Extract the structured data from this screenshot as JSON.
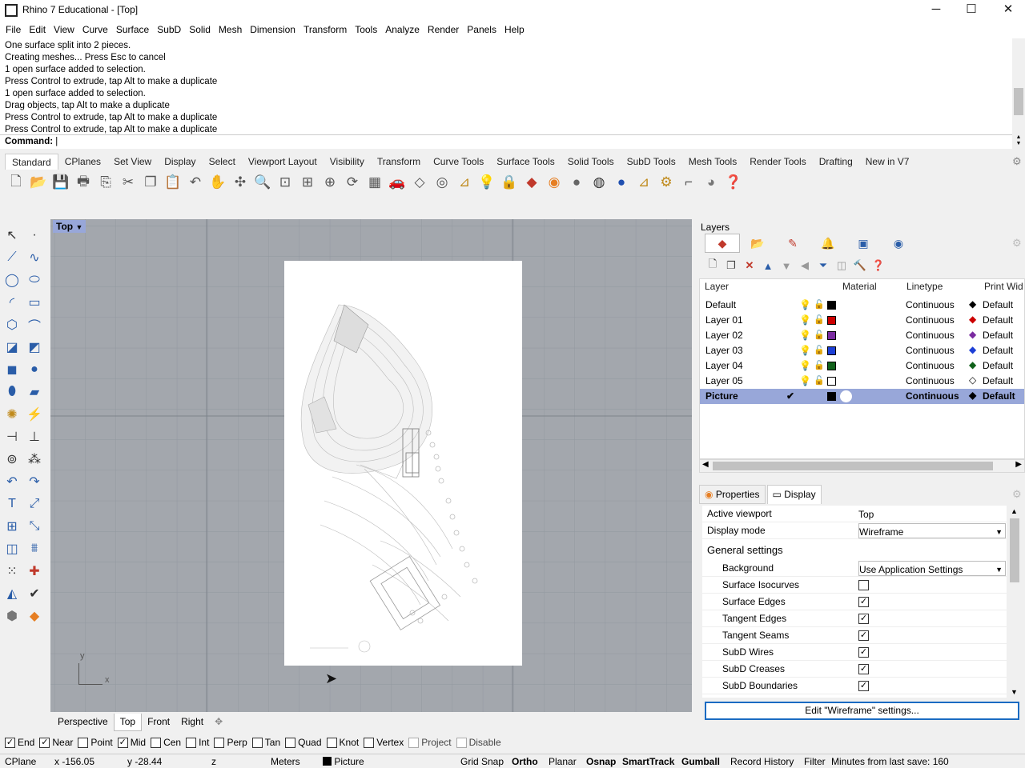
{
  "window": {
    "title": "Rhino 7 Educational - [Top]",
    "min": "─",
    "max": "☐",
    "close": "✕"
  },
  "menu": [
    "File",
    "Edit",
    "View",
    "Curve",
    "Surface",
    "SubD",
    "Solid",
    "Mesh",
    "Dimension",
    "Transform",
    "Tools",
    "Analyze",
    "Render",
    "Panels",
    "Help"
  ],
  "history": [
    "One surface split into 2 pieces.",
    "Creating meshes... Press Esc to cancel",
    "1 open surface added to selection.",
    "Press Control to extrude, tap Alt to make a duplicate",
    "1 open surface added to selection.",
    "Drag objects, tap Alt to make a duplicate",
    "Press Control to extrude, tap Alt to make a duplicate",
    "Press Control to extrude, tap Alt to make a duplicate"
  ],
  "command": {
    "label": "Command:"
  },
  "toolbar_tabs": [
    "Standard",
    "CPlanes",
    "Set View",
    "Display",
    "Select",
    "Viewport Layout",
    "Visibility",
    "Transform",
    "Curve Tools",
    "Surface Tools",
    "Solid Tools",
    "SubD Tools",
    "Mesh Tools",
    "Render Tools",
    "Drafting",
    "New in V7"
  ],
  "toolbar_icons": [
    "new-icon",
    "open-icon",
    "save-icon",
    "print-icon",
    "import-icon",
    "cut-icon",
    "copy-icon",
    "paste-icon",
    "undo-icon",
    "pan-icon",
    "rotate-view-icon",
    "zoom-icon",
    "zoom-window-icon",
    "zoom-extents-icon",
    "zoom-selected-icon",
    "rotate-icon",
    "four-viewports-icon",
    "car-icon",
    "grid-icon",
    "circle-icon",
    "snap-icon",
    "light-icon",
    "lock-icon",
    "layer-icon",
    "color-icon",
    "shade-icon",
    "render-icon",
    "material-icon",
    "dimension-icon",
    "options-icon",
    "select-icon",
    "sphere-icon",
    "help-icon"
  ],
  "viewport": {
    "label": "Top",
    "axis_y": "y",
    "axis_x": "x"
  },
  "viewport_tabs": [
    "Perspective",
    "Top",
    "Front",
    "Right"
  ],
  "layers": {
    "title": "Layers",
    "headers": {
      "layer": "Layer",
      "material": "Material",
      "linetype": "Linetype",
      "print_width": "Print Wid"
    },
    "rows": [
      {
        "name": "Default",
        "color": "#000000",
        "linetype": "Continuous",
        "print": "Default",
        "diamond": "#000000"
      },
      {
        "name": "Layer 01",
        "color": "#cc0000",
        "linetype": "Continuous",
        "print": "Default",
        "diamond": "#cc0000"
      },
      {
        "name": "Layer 02",
        "color": "#7a2ba0",
        "linetype": "Continuous",
        "print": "Default",
        "diamond": "#7a2ba0"
      },
      {
        "name": "Layer 03",
        "color": "#1c3fd6",
        "linetype": "Continuous",
        "print": "Default",
        "diamond": "#1c3fd6"
      },
      {
        "name": "Layer 04",
        "color": "#10611a",
        "linetype": "Continuous",
        "print": "Default",
        "diamond": "#10611a"
      },
      {
        "name": "Layer 05",
        "color": "#ffffff",
        "linetype": "Continuous",
        "print": "Default",
        "diamond": "#ffffff"
      },
      {
        "name": "Picture",
        "color": "#000000",
        "linetype": "Continuous",
        "print": "Default",
        "diamond": "#000000",
        "selected": true
      }
    ]
  },
  "props": {
    "tabs": [
      "Properties",
      "Display"
    ],
    "active_viewport_label": "Active viewport",
    "active_viewport": "Top",
    "display_mode_label": "Display mode",
    "display_mode": "Wireframe",
    "general": "General settings",
    "background_label": "Background",
    "background": "Use Application Settings",
    "checks": [
      {
        "label": "Surface Isocurves",
        "checked": false
      },
      {
        "label": "Surface Edges",
        "checked": true
      },
      {
        "label": "Tangent Edges",
        "checked": true
      },
      {
        "label": "Tangent Seams",
        "checked": true
      },
      {
        "label": "SubD Wires",
        "checked": true
      },
      {
        "label": "SubD Creases",
        "checked": true
      },
      {
        "label": "SubD Boundaries",
        "checked": true
      }
    ],
    "edit_button": "Edit \"Wireframe\" settings..."
  },
  "osnap": [
    {
      "label": "End",
      "checked": true
    },
    {
      "label": "Near",
      "checked": true
    },
    {
      "label": "Point",
      "checked": false
    },
    {
      "label": "Mid",
      "checked": true
    },
    {
      "label": "Cen",
      "checked": false
    },
    {
      "label": "Int",
      "checked": false
    },
    {
      "label": "Perp",
      "checked": false
    },
    {
      "label": "Tan",
      "checked": false
    },
    {
      "label": "Quad",
      "checked": false
    },
    {
      "label": "Knot",
      "checked": false
    },
    {
      "label": "Vertex",
      "checked": false
    },
    {
      "label": "Project",
      "checked": false,
      "dim": true
    },
    {
      "label": "Disable",
      "checked": false,
      "dim": true
    }
  ],
  "status": {
    "cplane": "CPlane",
    "x": "x -156.05",
    "y": "y -28.44",
    "z": "z",
    "units": "Meters",
    "layer": "Picture",
    "grid_snap": "Grid Snap",
    "ortho": "Ortho",
    "planar": "Planar",
    "osnap": "Osnap",
    "smarttrack": "SmartTrack",
    "gumball": "Gumball",
    "record_history": "Record History",
    "filter": "Filter",
    "minutes": "Minutes from last save: 160"
  }
}
